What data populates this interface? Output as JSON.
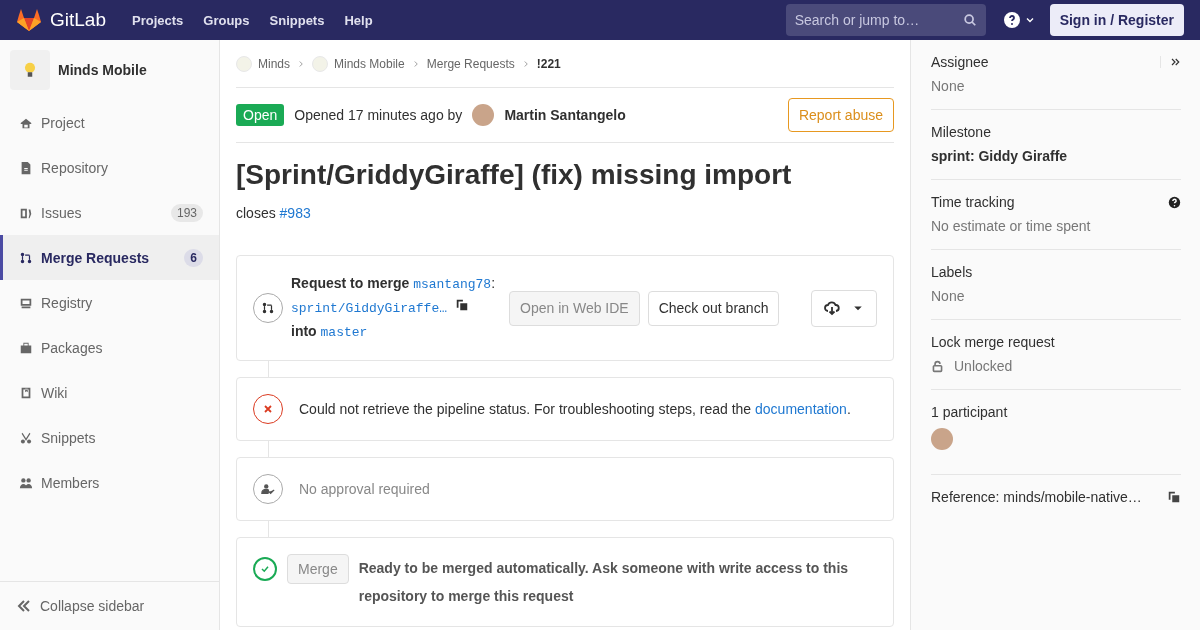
{
  "header": {
    "logo": "GitLab",
    "nav": [
      "Projects",
      "Groups",
      "Snippets",
      "Help"
    ],
    "search": {
      "placeholder": "Search or jump to…"
    },
    "sign_in": "Sign in / Register"
  },
  "sidebar": {
    "project": "Minds Mobile",
    "items": [
      {
        "label": "Project",
        "selected": false
      },
      {
        "label": "Repository",
        "selected": false
      },
      {
        "label": "Issues",
        "count": "193",
        "selected": false
      },
      {
        "label": "Merge Requests",
        "count": "6",
        "selected": true
      },
      {
        "label": "Registry",
        "selected": false
      },
      {
        "label": "Packages",
        "selected": false
      },
      {
        "label": "Wiki",
        "selected": false
      },
      {
        "label": "Snippets",
        "selected": false
      },
      {
        "label": "Members",
        "selected": false
      }
    ],
    "collapse": "Collapse sidebar"
  },
  "breadcrumbs": [
    {
      "label": "Minds",
      "kind": "project"
    },
    {
      "label": "Minds Mobile",
      "kind": "project"
    },
    {
      "label": "Merge Requests",
      "kind": "link"
    },
    {
      "label": "!221",
      "kind": "current"
    }
  ],
  "merge_request": {
    "status": "Open",
    "opened": "Opened 17 minutes ago by",
    "author": "Martin Santangelo",
    "report": "Report abuse",
    "title": "[Sprint/GriddyGiraffe] (fix) missing import",
    "description": "closes",
    "issue_link": "#983"
  },
  "widget": {
    "request": "Request to merge",
    "source_user": "msantang78",
    "separator": ":",
    "source_branch": "sprint/GiddyGiraffe…",
    "into": "into",
    "target": "master",
    "buttons": [
      {
        "label": "Open in Web IDE",
        "disabled": true
      },
      {
        "label": "Check out branch",
        "disabled": false
      }
    ]
  },
  "pipeline": {
    "text": "Could not retrieve the pipeline status. For troubleshooting steps, read the",
    "link": "documentation",
    "end": "."
  },
  "approval": {
    "text": "No approval required"
  },
  "merge": {
    "button": "Merge",
    "disabled": true,
    "text": "Ready to be merged automatically. Ask someone with write access to this repository to merge this request"
  },
  "right_sidebar": [
    {
      "label": "Assignee",
      "value": "None",
      "kind": "plain"
    },
    {
      "label": "Milestone",
      "value": "sprint: Giddy Giraffe",
      "kind": "bold"
    },
    {
      "label": "Time tracking",
      "value": "No estimate or time spent",
      "kind": "help"
    },
    {
      "label": "Labels",
      "value": "None",
      "kind": "plain"
    },
    {
      "label": "Lock merge request",
      "value": "Unlocked",
      "kind": "lock"
    },
    {
      "label": "1 participant",
      "kind": "avatars"
    },
    {
      "label": "Reference: minds/mobile-native…",
      "kind": "copy"
    }
  ]
}
